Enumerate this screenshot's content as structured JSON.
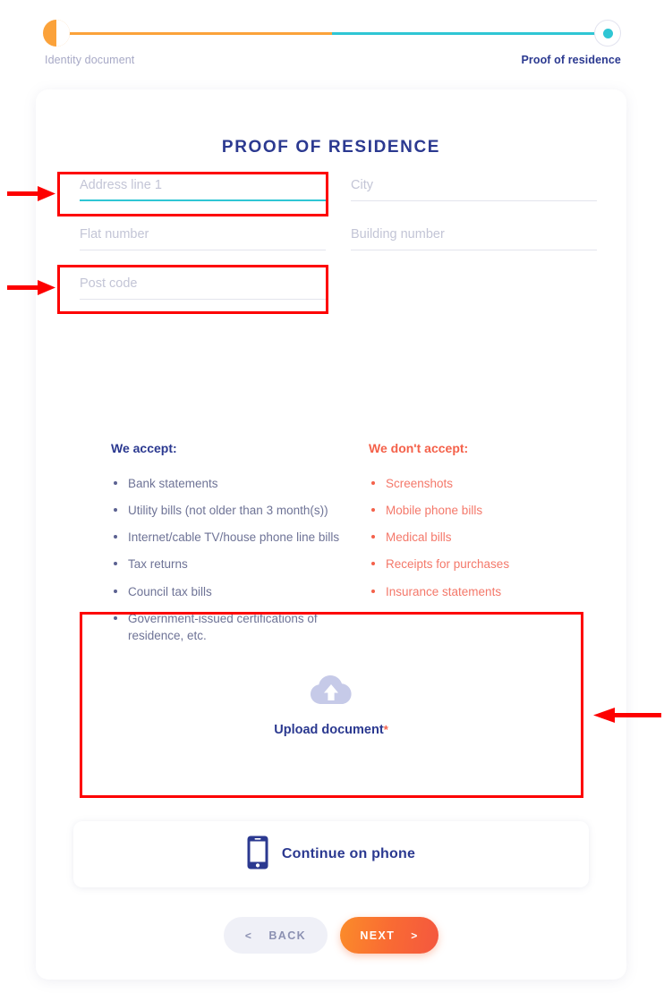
{
  "stepper": {
    "steps": [
      {
        "label": "Identity document",
        "state": "in-progress"
      },
      {
        "label": "Proof of residence",
        "state": "current"
      }
    ],
    "colors": {
      "done": "#FBA23A",
      "current": "#2FC6D4"
    }
  },
  "card": {
    "title": "PROOF OF RESIDENCE"
  },
  "form": {
    "fields": [
      {
        "name": "address-line-1",
        "placeholder": "Address line 1",
        "value": "",
        "focused": true
      },
      {
        "name": "city",
        "placeholder": "City",
        "value": "",
        "focused": false
      },
      {
        "name": "flat-number",
        "placeholder": "Flat number",
        "value": "",
        "focused": false
      },
      {
        "name": "building-number",
        "placeholder": "Building number",
        "value": "",
        "focused": false
      },
      {
        "name": "post-code",
        "placeholder": "Post code",
        "value": "",
        "focused": false
      }
    ]
  },
  "accept": {
    "heading": "We accept:",
    "items": [
      "Bank statements",
      "Utility bills (not older than 3 month(s))",
      "Internet/cable TV/house phone line bills",
      "Tax returns",
      "Council tax bills",
      "Government-issued certifications of residence, etc."
    ]
  },
  "reject": {
    "heading": "We don't accept:",
    "items": [
      "Screenshots",
      "Mobile phone bills",
      "Medical bills",
      "Receipts for purchases",
      "Insurance statements"
    ]
  },
  "upload": {
    "icon": "cloud-upload-icon",
    "label": "Upload document",
    "required_marker": "*"
  },
  "phone": {
    "icon": "mobile-phone-icon",
    "label": "Continue on phone"
  },
  "footer": {
    "back_label": "BACK",
    "back_chevron": "<",
    "next_label": "NEXT",
    "next_chevron": ">"
  },
  "annotations": {
    "color": "#fd0000",
    "arrows": [
      {
        "name": "arrow-address-line-1",
        "direction": "right"
      },
      {
        "name": "arrow-post-code",
        "direction": "right"
      },
      {
        "name": "arrow-upload-document",
        "direction": "left"
      }
    ],
    "boxes": [
      {
        "name": "highlight-address-line-1"
      },
      {
        "name": "highlight-post-code"
      },
      {
        "name": "highlight-upload-document"
      }
    ]
  }
}
